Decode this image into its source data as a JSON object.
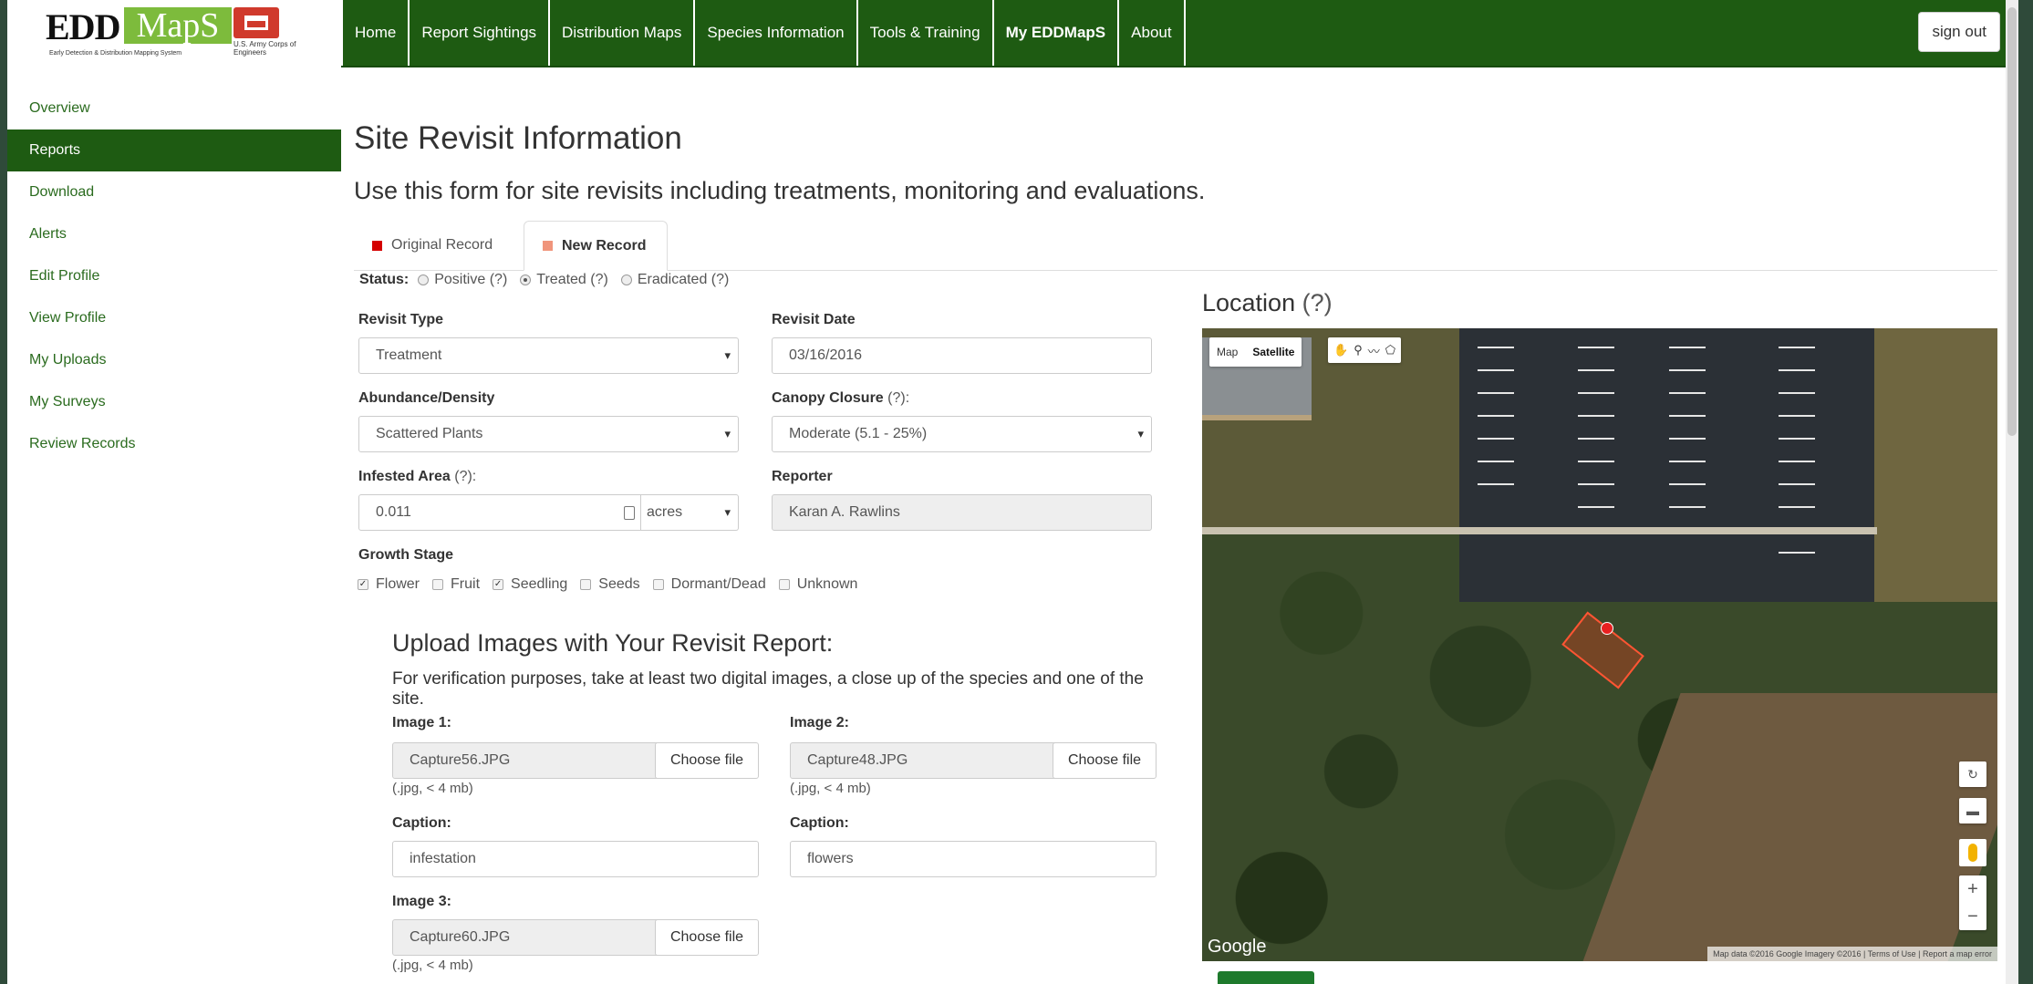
{
  "logo": {
    "brand_a": "EDD",
    "brand_b": "MapS",
    "tagline": "Early Detection & Distribution Mapping System",
    "partner": "U.S. Army Corps of Engineers"
  },
  "topnav": {
    "items": [
      "Home",
      "Report Sightings",
      "Distribution Maps",
      "Species Information",
      "Tools & Training",
      "My EDDMapS",
      "About"
    ],
    "active": "My EDDMapS",
    "sign_out": "sign out"
  },
  "sidebar": {
    "items": [
      "Overview",
      "Reports",
      "Download",
      "Alerts",
      "Edit Profile",
      "View Profile",
      "My Uploads",
      "My Surveys",
      "Review Records"
    ],
    "active": "Reports"
  },
  "page": {
    "title": "Site Revisit Information",
    "intro": "Use this form for site revisits including treatments, monitoring and evaluations."
  },
  "tabs": {
    "original": "Original Record",
    "new": "New Record"
  },
  "status": {
    "label": "Status:",
    "options": [
      "Positive",
      "Treated",
      "Eradicated"
    ],
    "help": "(?)",
    "selected": "Treated"
  },
  "form": {
    "revisit_type_label": "Revisit Type",
    "revisit_type_value": "Treatment",
    "revisit_date_label": "Revisit Date",
    "revisit_date_value": "03/16/2016",
    "abundance_label": "Abundance/Density",
    "abundance_value": "Scattered Plants",
    "canopy_label": "Canopy Closure",
    "canopy_help": "(?):",
    "canopy_value": "Moderate (5.1 - 25%)",
    "infested_label": "Infested Area",
    "infested_help": "(?):",
    "infested_value": "0.011",
    "infested_unit": "acres",
    "reporter_label": "Reporter",
    "reporter_value": "Karan A. Rawlins",
    "growth_label": "Growth Stage",
    "growth_options": [
      {
        "label": "Flower",
        "checked": true
      },
      {
        "label": "Fruit",
        "checked": false
      },
      {
        "label": "Seedling",
        "checked": true
      },
      {
        "label": "Seeds",
        "checked": false
      },
      {
        "label": "Dormant/Dead",
        "checked": false
      },
      {
        "label": "Unknown",
        "checked": false
      }
    ]
  },
  "upload": {
    "title": "Upload Images with Your Revisit Report:",
    "note": "For verification purposes, take at least two digital images, a close up of the species and one of the site.",
    "choose_label": "Choose file",
    "hint": "(.jpg, < 4 mb)",
    "caption_label": "Caption:",
    "image1_label": "Image 1:",
    "image1_file": "Capture56.JPG",
    "image1_caption": "infestation",
    "image2_label": "Image 2:",
    "image2_file": "Capture48.JPG",
    "image2_caption": "flowers",
    "image3_label": "Image 3:",
    "image3_file": "Capture60.JPG"
  },
  "location": {
    "title": "Location",
    "help": "(?)",
    "map_type": [
      "Map",
      "Satellite"
    ],
    "map_type_active": "Satellite",
    "tool_icons": [
      "hand-icon",
      "marker-icon",
      "line-icon",
      "polygon-icon"
    ],
    "google": "Google",
    "attribution": "Map data ©2016 Google Imagery ©2016  |  Terms of Use  |  Report a map error"
  },
  "colors": {
    "nav_green": "#1e5b12",
    "link_green": "#2a6b1e",
    "original_marker": "#d40000",
    "new_marker": "#f0957c",
    "polygon": "#ff5533"
  }
}
